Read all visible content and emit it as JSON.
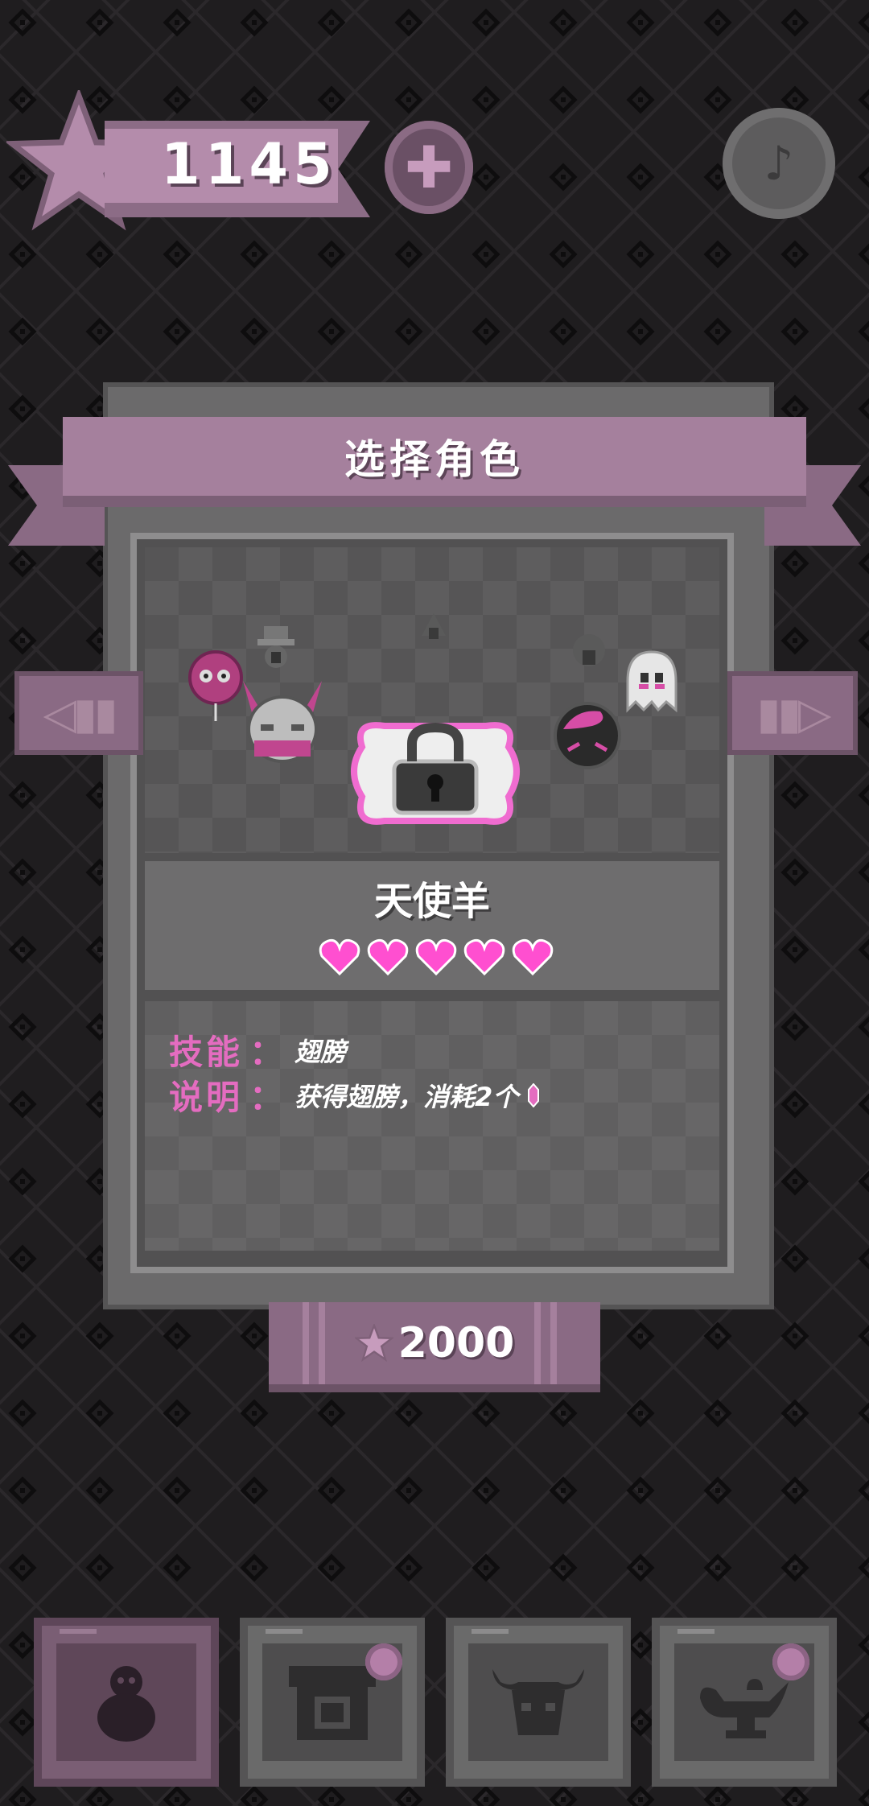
{
  "top_bar": {
    "score": "1145",
    "add_button_icon": "plus-icon",
    "music_button_icon": "music-note-icon"
  },
  "panel": {
    "title": "选择角色",
    "character": {
      "name": "天使羊",
      "hearts": 5,
      "skill_label": "技能",
      "skill_colon": "：",
      "skill_value": "翅膀",
      "desc_label": "说明",
      "desc_colon": "：",
      "desc_value": "获得翅膀，消耗2个"
    },
    "price": "2000"
  },
  "colors": {
    "accent_pink": "#e46cc0",
    "ribbon": "#8a6a84",
    "heart": "#ff4fd0"
  },
  "nav": [
    {
      "icon": "character-icon",
      "active": true
    },
    {
      "icon": "shop-icon",
      "active": false,
      "badge": true
    },
    {
      "icon": "bull-head-icon",
      "active": false
    },
    {
      "icon": "magic-lamp-icon",
      "active": false,
      "badge": true
    }
  ]
}
